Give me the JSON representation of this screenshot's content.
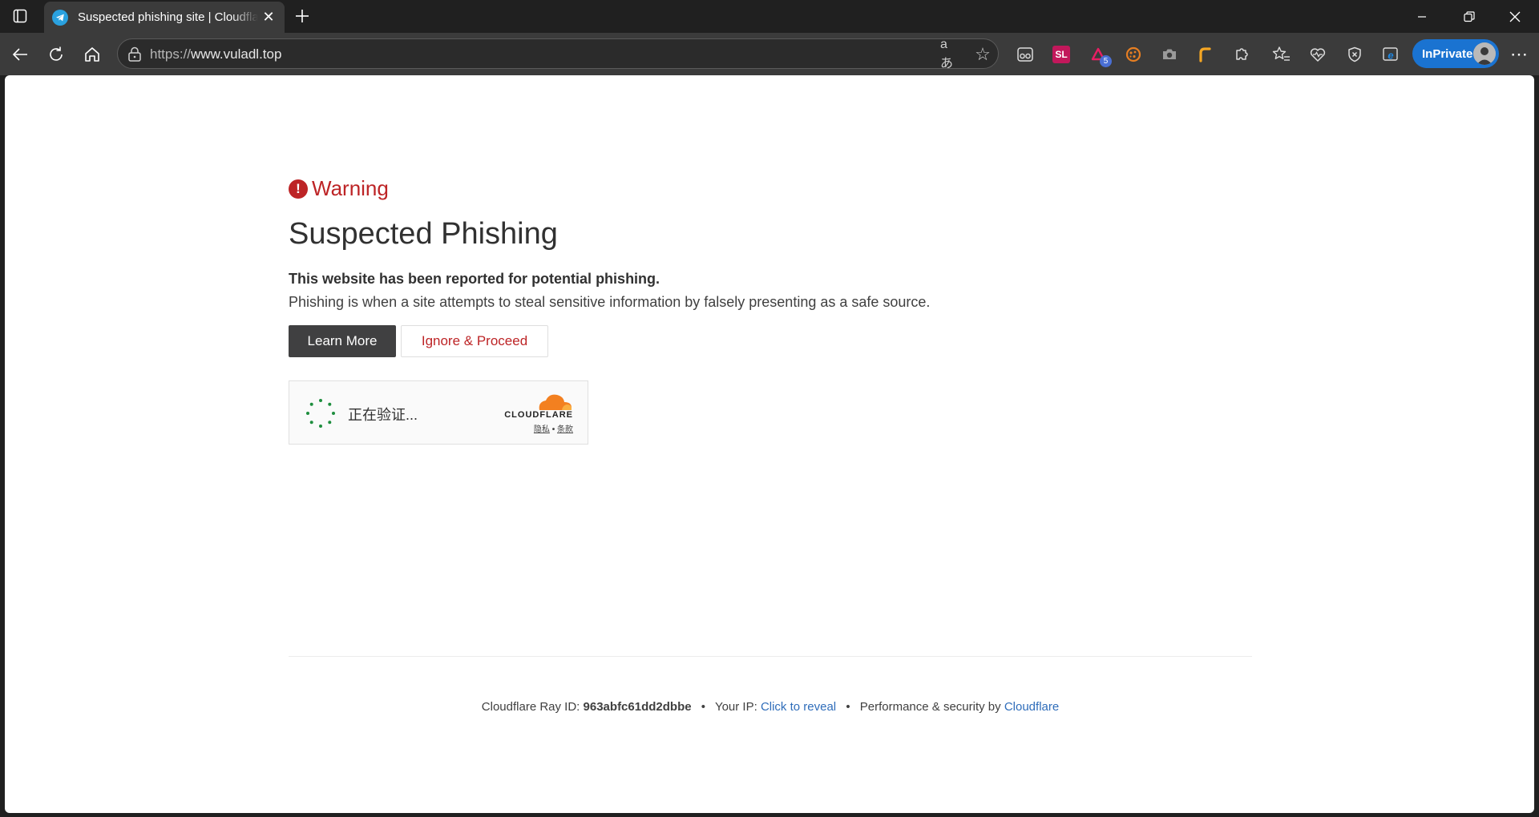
{
  "browser": {
    "tab": {
      "title": "Suspected phishing site | Cloudflare",
      "close": "✕"
    },
    "new_tab": "+",
    "window_controls": {
      "minimize": "—",
      "maximize": "❐",
      "close": "✕"
    },
    "address": {
      "scheme": "https://",
      "host": "www.vuladl.top"
    },
    "address_icons": {
      "read_aloud": "aあ",
      "favorite": "☆"
    },
    "extensions": [
      {
        "name": "glasses-extension-icon"
      },
      {
        "name": "sl-extension-icon",
        "label": "SL",
        "color": "#c2185b"
      },
      {
        "name": "triangle-extension-icon",
        "badge": "5",
        "color": "#e91e63"
      },
      {
        "name": "cookie-extension-icon",
        "color": "#e67e22"
      },
      {
        "name": "camera-extension-icon"
      },
      {
        "name": "pen-extension-icon",
        "color": "#f5a623"
      },
      {
        "name": "puzzle-extensions-icon"
      },
      {
        "name": "favorites-icon"
      },
      {
        "name": "browser-essentials-icon"
      },
      {
        "name": "shield-icon"
      },
      {
        "name": "ie-mode-icon",
        "color": "#1e88e5"
      }
    ],
    "inprivate_label": "InPrivate",
    "more_menu": "⋯"
  },
  "page": {
    "warning_icon": "!",
    "warning_label": "Warning",
    "heading": "Suspected Phishing",
    "bold_line": "This website has been reported for potential phishing.",
    "description": "Phishing is when a site attempts to steal sensitive information by falsely presenting as a safe source.",
    "learn_more": "Learn More",
    "ignore_proceed": "Ignore & Proceed",
    "turnstile": {
      "status": "正在验证...",
      "brand": "CLOUDFLARE",
      "privacy": "隐私",
      "dot": "•",
      "terms": "条款"
    },
    "footer": {
      "ray_label": "Cloudflare Ray ID:",
      "ray_id": "963abfc61dd2dbbe",
      "bullet": "•",
      "ip_label": "Your IP:",
      "ip_link": "Click to reveal",
      "perf_label": "Performance & security by",
      "perf_link": "Cloudflare"
    }
  },
  "colors": {
    "warning_red": "#bd2426",
    "link_blue": "#2f6dba",
    "inprivate_blue": "#1a73d1",
    "cloudflare_orange": "#f38020",
    "spinner_green": "#1e8e3e"
  }
}
